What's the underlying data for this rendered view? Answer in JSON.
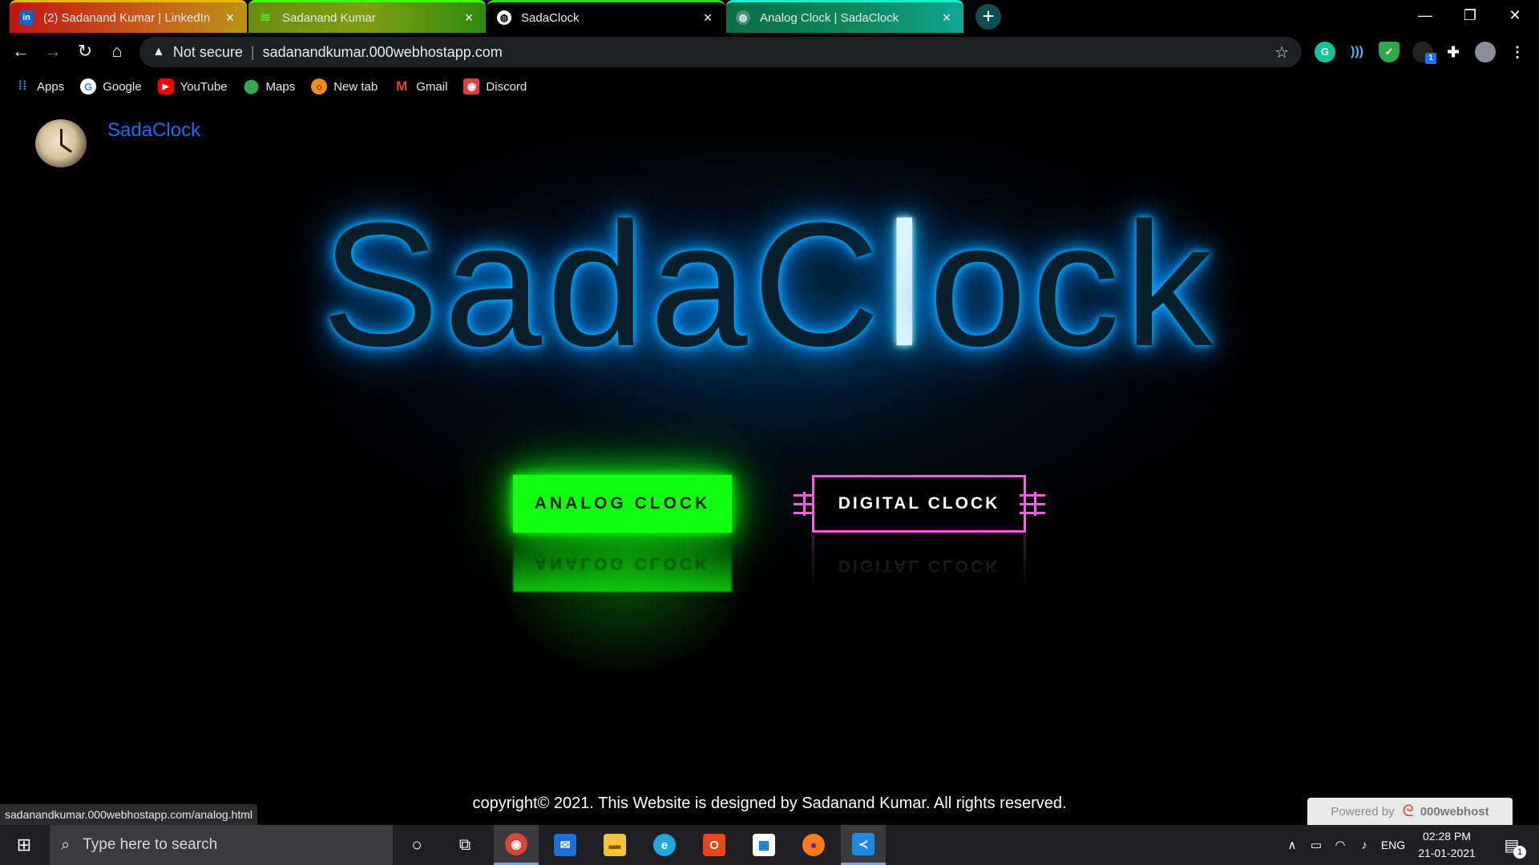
{
  "browser": {
    "tabs": [
      {
        "title": "(2) Sadanand Kumar | LinkedIn",
        "icon": "linkedin-icon"
      },
      {
        "title": "Sadanand Kumar",
        "icon": "site-icon"
      },
      {
        "title": "SadaClock",
        "icon": "globe-icon",
        "active": true
      },
      {
        "title": "Analog Clock | SadaClock",
        "icon": "globe-icon"
      }
    ],
    "new_tab": "+",
    "address": {
      "security": "Not secure",
      "url": "sadanandkumar.000webhostapp.com"
    },
    "extensions": {
      "grammarly": "G",
      "badge": "1"
    },
    "bookmarks": [
      {
        "label": "Apps",
        "icon": "apps-grid-icon"
      },
      {
        "label": "Google",
        "icon": "google-icon"
      },
      {
        "label": "YouTube",
        "icon": "youtube-icon"
      },
      {
        "label": "Maps",
        "icon": "maps-pin-icon"
      },
      {
        "label": "New tab",
        "icon": "newtab-icon"
      },
      {
        "label": "Gmail",
        "icon": "gmail-icon"
      },
      {
        "label": "Discord",
        "icon": "discord-icon"
      }
    ]
  },
  "page": {
    "brand": "SadaClock",
    "hero": {
      "before": "SadaC",
      "lit": "l",
      "after": "ock"
    },
    "analog_button": "ANALOG CLOCK",
    "digital_button": "DIGITAL CLOCK",
    "copyright": "copyright© 2021. This Website is designed by Sadanand Kumar. All rights reserved.",
    "status_url": "sadanandkumar.000webhostapp.com/analog.html",
    "powered_by": "Powered by",
    "host_name": "000webhost"
  },
  "taskbar": {
    "search_placeholder": "Type here to search",
    "language": "ENG",
    "time": "02:28 PM",
    "date": "21-01-2021",
    "notification_count": "1"
  },
  "colors": {
    "hero_glow": "#00a6ff",
    "analog_green": "#12ff12",
    "digital_pink": "#ff5ce4",
    "brand_link": "#1a6cf5"
  }
}
